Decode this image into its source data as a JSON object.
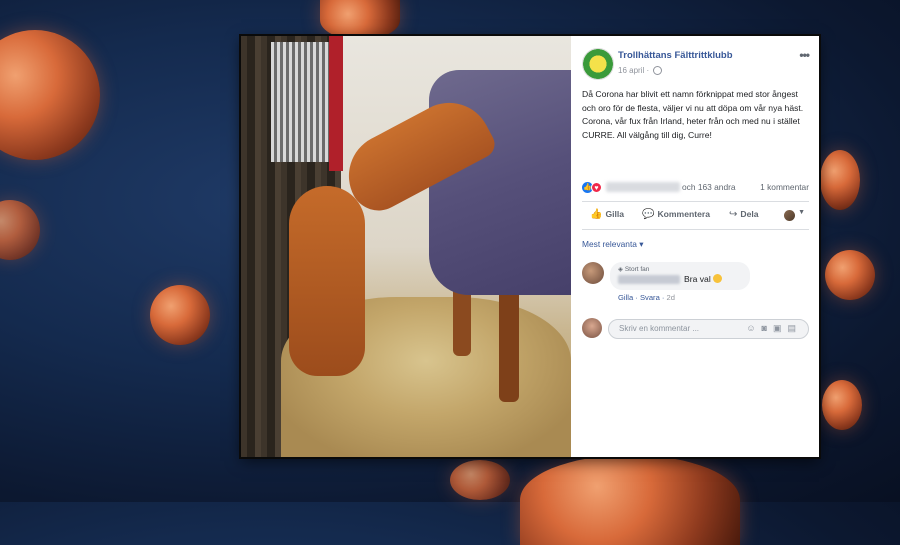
{
  "post": {
    "page_name": "Trollhättans Fälttrittklubb",
    "date": "16 april",
    "more_label": "•••",
    "text": "Då Corona har blivit ett namn förknippat med stor ångest och oro för de flesta, väljer vi nu att döpa om vår nya häst. Corona, vår fux från Irland, heter från och med nu i stället CURRE. All välgång till dig, Curre!",
    "reactions": {
      "others": "och 163 andra",
      "comments": "1 kommentar"
    },
    "actions": {
      "like": "Gilla",
      "comment": "Kommentera",
      "share": "Dela"
    },
    "comment_sort": "Mest relevanta ▾",
    "comment": {
      "badge": "Stort fan",
      "text": "Bra val",
      "like": "Gilla",
      "reply": "Svara",
      "time": "2d"
    },
    "write_placeholder": "Skriv en kommentar ..."
  },
  "icons": [
    "like-icon",
    "love-icon",
    "globe-icon",
    "comment-icon",
    "share-icon",
    "emoji-icon",
    "camera-icon",
    "gif-icon",
    "sticker-icon"
  ]
}
